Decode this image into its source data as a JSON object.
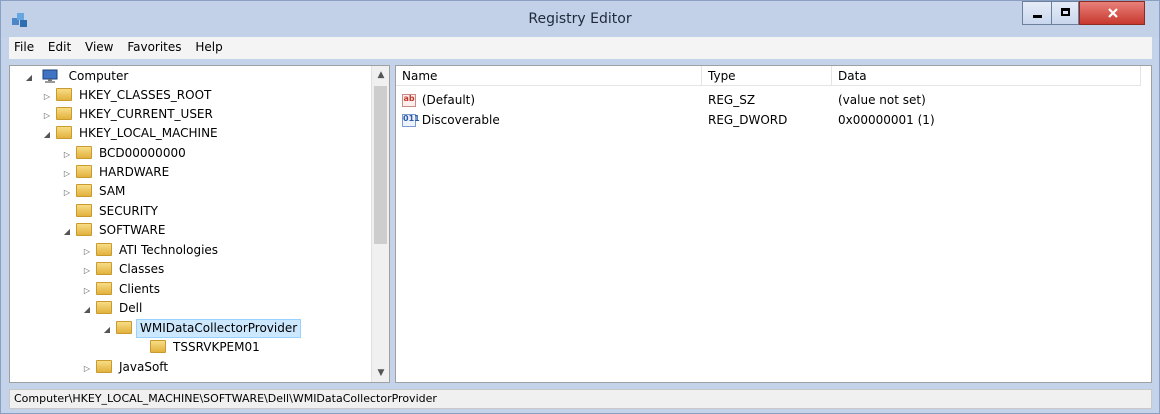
{
  "window": {
    "title": "Registry Editor",
    "icon": "registry-icon"
  },
  "menu": [
    "File",
    "Edit",
    "View",
    "Favorites",
    "Help"
  ],
  "tree": {
    "root": "Computer",
    "items": [
      {
        "label": "HKEY_CLASSES_ROOT",
        "expander": "▷"
      },
      {
        "label": "HKEY_CURRENT_USER",
        "expander": "▷"
      },
      {
        "label": "HKEY_LOCAL_MACHINE",
        "expander": "◢"
      },
      {
        "label": "BCD00000000",
        "expander": "▷"
      },
      {
        "label": "HARDWARE",
        "expander": "▷"
      },
      {
        "label": "SAM",
        "expander": "▷"
      },
      {
        "label": "SECURITY",
        "expander": ""
      },
      {
        "label": "SOFTWARE",
        "expander": "◢"
      },
      {
        "label": "ATI Technologies",
        "expander": "▷"
      },
      {
        "label": "Classes",
        "expander": "▷"
      },
      {
        "label": "Clients",
        "expander": "▷"
      },
      {
        "label": "Dell",
        "expander": "◢"
      },
      {
        "label": "WMIDataCollectorProvider",
        "expander": "◢"
      },
      {
        "label": "TSSRVKPEM01",
        "expander": ""
      },
      {
        "label": "JavaSoft",
        "expander": "▷"
      }
    ]
  },
  "values": {
    "headers": {
      "name": "Name",
      "type": "Type",
      "data": "Data"
    },
    "rows": [
      {
        "name": "(Default)",
        "type": "REG_SZ",
        "data": "(value not set)",
        "icon": "string-value-icon",
        "glyph": "ab"
      },
      {
        "name": "Discoverable",
        "type": "REG_DWORD",
        "data": "0x00000001 (1)",
        "icon": "binary-value-icon",
        "glyph": "011"
      }
    ]
  },
  "status": "Computer\\HKEY_LOCAL_MACHINE\\SOFTWARE\\Dell\\WMIDataCollectorProvider"
}
